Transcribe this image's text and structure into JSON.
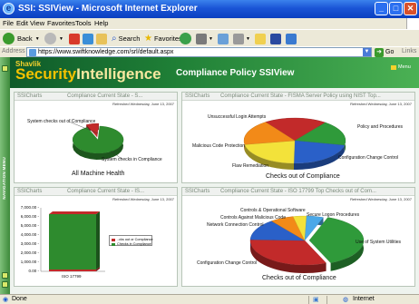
{
  "window": {
    "title": "SSI: SSIView - Microsoft Internet Explorer"
  },
  "menu": [
    "File",
    "Edit",
    "View",
    "Favorites",
    "Tools",
    "Help"
  ],
  "toolbar": {
    "back_label": "Back",
    "search_label": "Search",
    "favorites_label": "Favorites"
  },
  "address": {
    "label": "Address",
    "url": "https://www.swiftknowledge.com/srl/default.aspx",
    "go_label": "Go",
    "links_label": "Links"
  },
  "header": {
    "logo_top": "Shavlik",
    "logo_part1": "Security",
    "logo_part2": "Intelligence",
    "page_title": "Compliance Policy SSIView",
    "menu_label": "Menu"
  },
  "sidebar": {
    "nav_label": "NAVIGATION MENU"
  },
  "panels": [
    {
      "source": "SSICharts",
      "title": "Compliance Current State - S...",
      "refreshed": "Refreshed Wednesday, June 13, 2007",
      "caption": "All Machine Health",
      "labels": [
        "System checks out of Compliance",
        "System checks in Compliance"
      ]
    },
    {
      "source": "SSICharts",
      "title": "Compliance Current State - FISMA Server Policy using NIST Top...",
      "refreshed": "Refreshed Wednesday, June 13, 2007",
      "caption": "Checks out of Compliance",
      "labels": [
        "Unsuccessful Login Attempts",
        "Policy and Procedures",
        "Malicious Code Protection",
        "Configuration Change Control",
        "Flaw Remediation"
      ]
    },
    {
      "source": "SSICharts",
      "title": "Compliance Current State - IS...",
      "refreshed": "Refreshed Wednesday, June 13, 2007",
      "y_ticks": [
        "7,000.00 -",
        "6,000.00 -",
        "5,000.00 -",
        "4,000.00 -",
        "3,000.00 -",
        "2,000.00 -",
        "1,000.00 -",
        "0.00 -"
      ],
      "x_label": "ISO 17799",
      "legend": [
        "..cks out or Compliance",
        "Checks in Compliance"
      ]
    },
    {
      "source": "SSICharts",
      "title": "Compliance Current State - ISO 17799 Top Checks out of Com...",
      "refreshed": "Refreshed Wednesday, June 13, 2007",
      "caption": "Checks out of Compliance",
      "labels": [
        "Controls & Operational Software",
        "Controls Against Malicious Code",
        "Network Connection Control",
        "Secure Logon Procedures",
        "Use of System Utilities",
        "Configuration Change Control"
      ]
    }
  ],
  "status": {
    "done": "Done",
    "zone": "Internet"
  },
  "chart_data": [
    {
      "type": "pie",
      "title": "All Machine Health",
      "categories": [
        "System checks out of Compliance",
        "System checks in Compliance"
      ],
      "values": [
        8,
        92
      ],
      "colors": [
        "#c22a2a",
        "#2e8b2e"
      ]
    },
    {
      "type": "pie",
      "title": "Checks out of Compliance",
      "categories": [
        "Unsuccessful Login Attempts",
        "Policy and Procedures",
        "Configuration Change Control",
        "Flaw Remediation",
        "Malicious Code Protection"
      ],
      "values": [
        20,
        18,
        22,
        22,
        18
      ],
      "colors": [
        "#c22a2a",
        "#2f9a3a",
        "#2a60c8",
        "#f3e23a",
        "#f28a18"
      ]
    },
    {
      "type": "bar",
      "categories": [
        "ISO 17799"
      ],
      "series": [
        {
          "name": "..cks out or Compliance",
          "values": [
            200
          ]
        },
        {
          "name": "Checks in Compliance",
          "values": [
            6100
          ]
        }
      ],
      "ylim": [
        0,
        7000
      ],
      "colors": [
        "#c22a2a",
        "#2e8b2e"
      ]
    },
    {
      "type": "pie",
      "title": "Checks out of Compliance",
      "categories": [
        "Use of System Utilities",
        "Configuration Change Control",
        "Network Connection Control",
        "Controls Against Malicious Code",
        "Controls & Operational Software",
        "Secure Logon Procedures"
      ],
      "values": [
        38,
        32,
        14,
        7,
        4,
        5
      ],
      "colors": [
        "#2f9a3a",
        "#c22a2a",
        "#2a60c8",
        "#f28a18",
        "#f3e23a",
        "#4aa8e8"
      ]
    }
  ]
}
